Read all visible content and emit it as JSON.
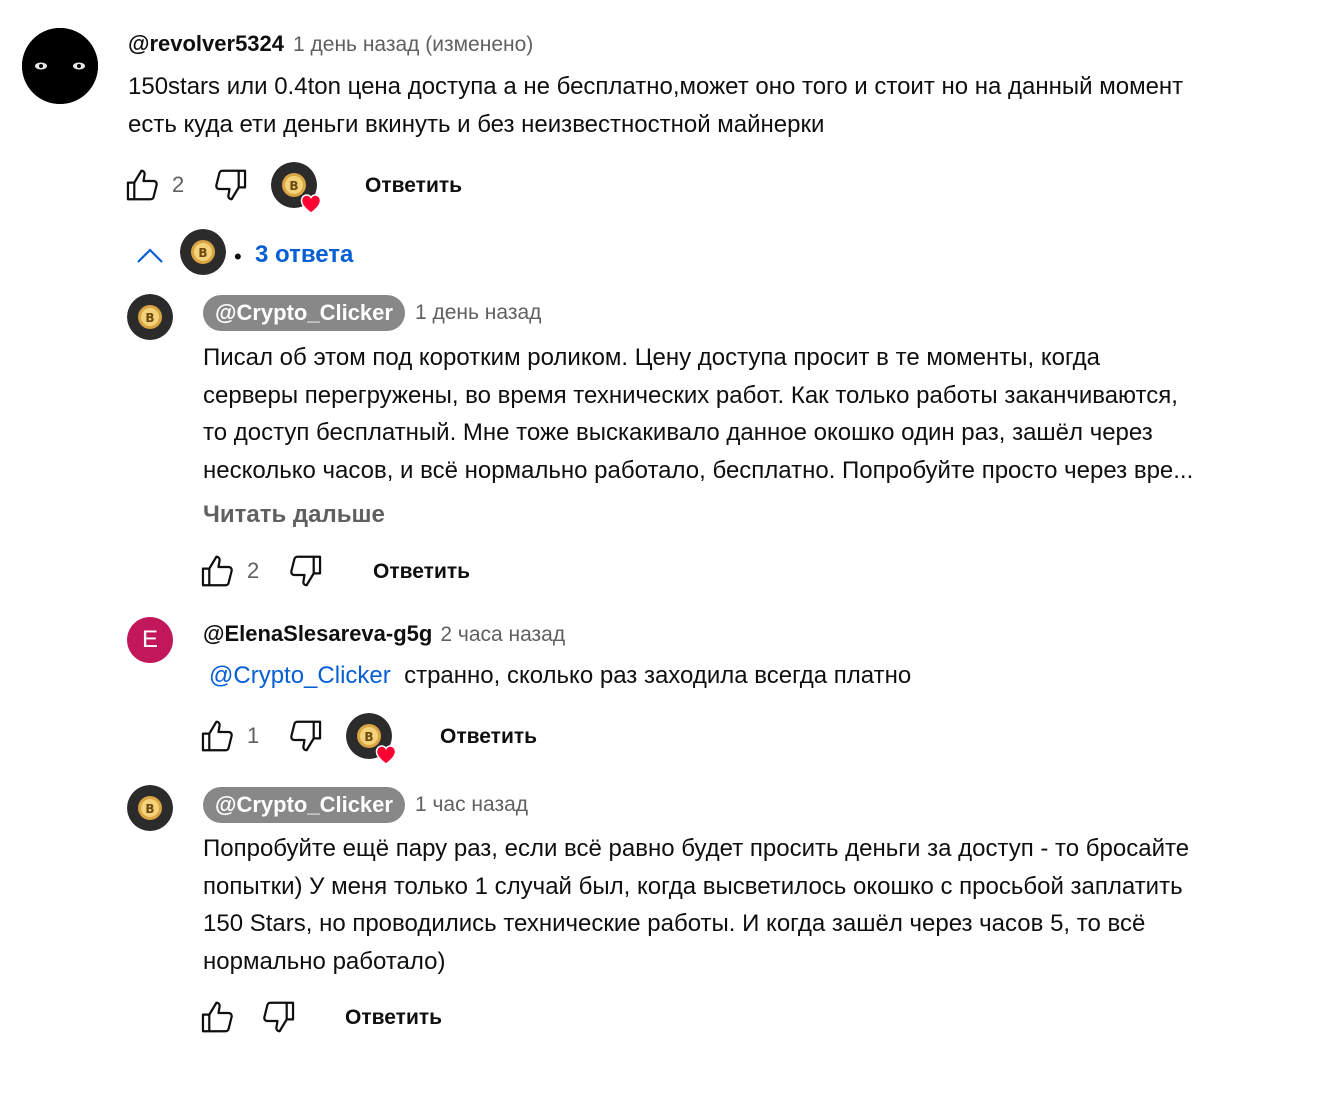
{
  "comment": {
    "author": "@revolver5324",
    "time": "1 день назад (изменено)",
    "text_line1": "150stars или 0.4ton цена доступа а не бесплатно,может оно того и стоит но на данный момент",
    "text_line2": "есть куда ети деньги вкинуть и без неизвестностной майнерки",
    "likes": "2",
    "reply_label": "Ответить"
  },
  "replies_toggle": {
    "dot": "•",
    "label": "3 ответа"
  },
  "replies": [
    {
      "author": "@Crypto_Clicker",
      "time": "1 день назад",
      "lines": [
        "Писал об этом под коротким роликом. Цену доступа просит в те моменты, когда",
        "серверы перегружены, во время технических работ. Как только работы заканчиваются,",
        "то доступ бесплатный. Мне тоже выскакивало данное окошко один раз, зашёл через",
        "несколько часов, и всё нормально работало, бесплатно. Попробуйте просто через вре..."
      ],
      "read_more": "Читать дальше",
      "likes": "2",
      "reply_label": "Ответить"
    },
    {
      "author": "@ElenaSlesareva-g5g",
      "avatar_letter": "E",
      "time": "2 часа назад",
      "mention": "@Crypto_Clicker",
      "text": "странно, сколько раз заходила всегда платно",
      "likes": "1",
      "reply_label": "Ответить"
    },
    {
      "author": "@Crypto_Clicker",
      "time": "1 час назад",
      "lines": [
        "Попробуйте ещё пару раз, если всё равно будет просить деньги за доступ - то бросайте",
        "попытки) У меня только 1 случай был, когда высветилось окошко с просьбой заплатить",
        "150 Stars, но проводились технические работы. И когда зашёл через часов 5, то всё",
        "нормально работало)"
      ],
      "reply_label": "Ответить"
    }
  ],
  "colors": {
    "link": "#065fd4",
    "pill": "#888888",
    "elena_avatar": "#c2185b",
    "heart": "#ff0033"
  }
}
